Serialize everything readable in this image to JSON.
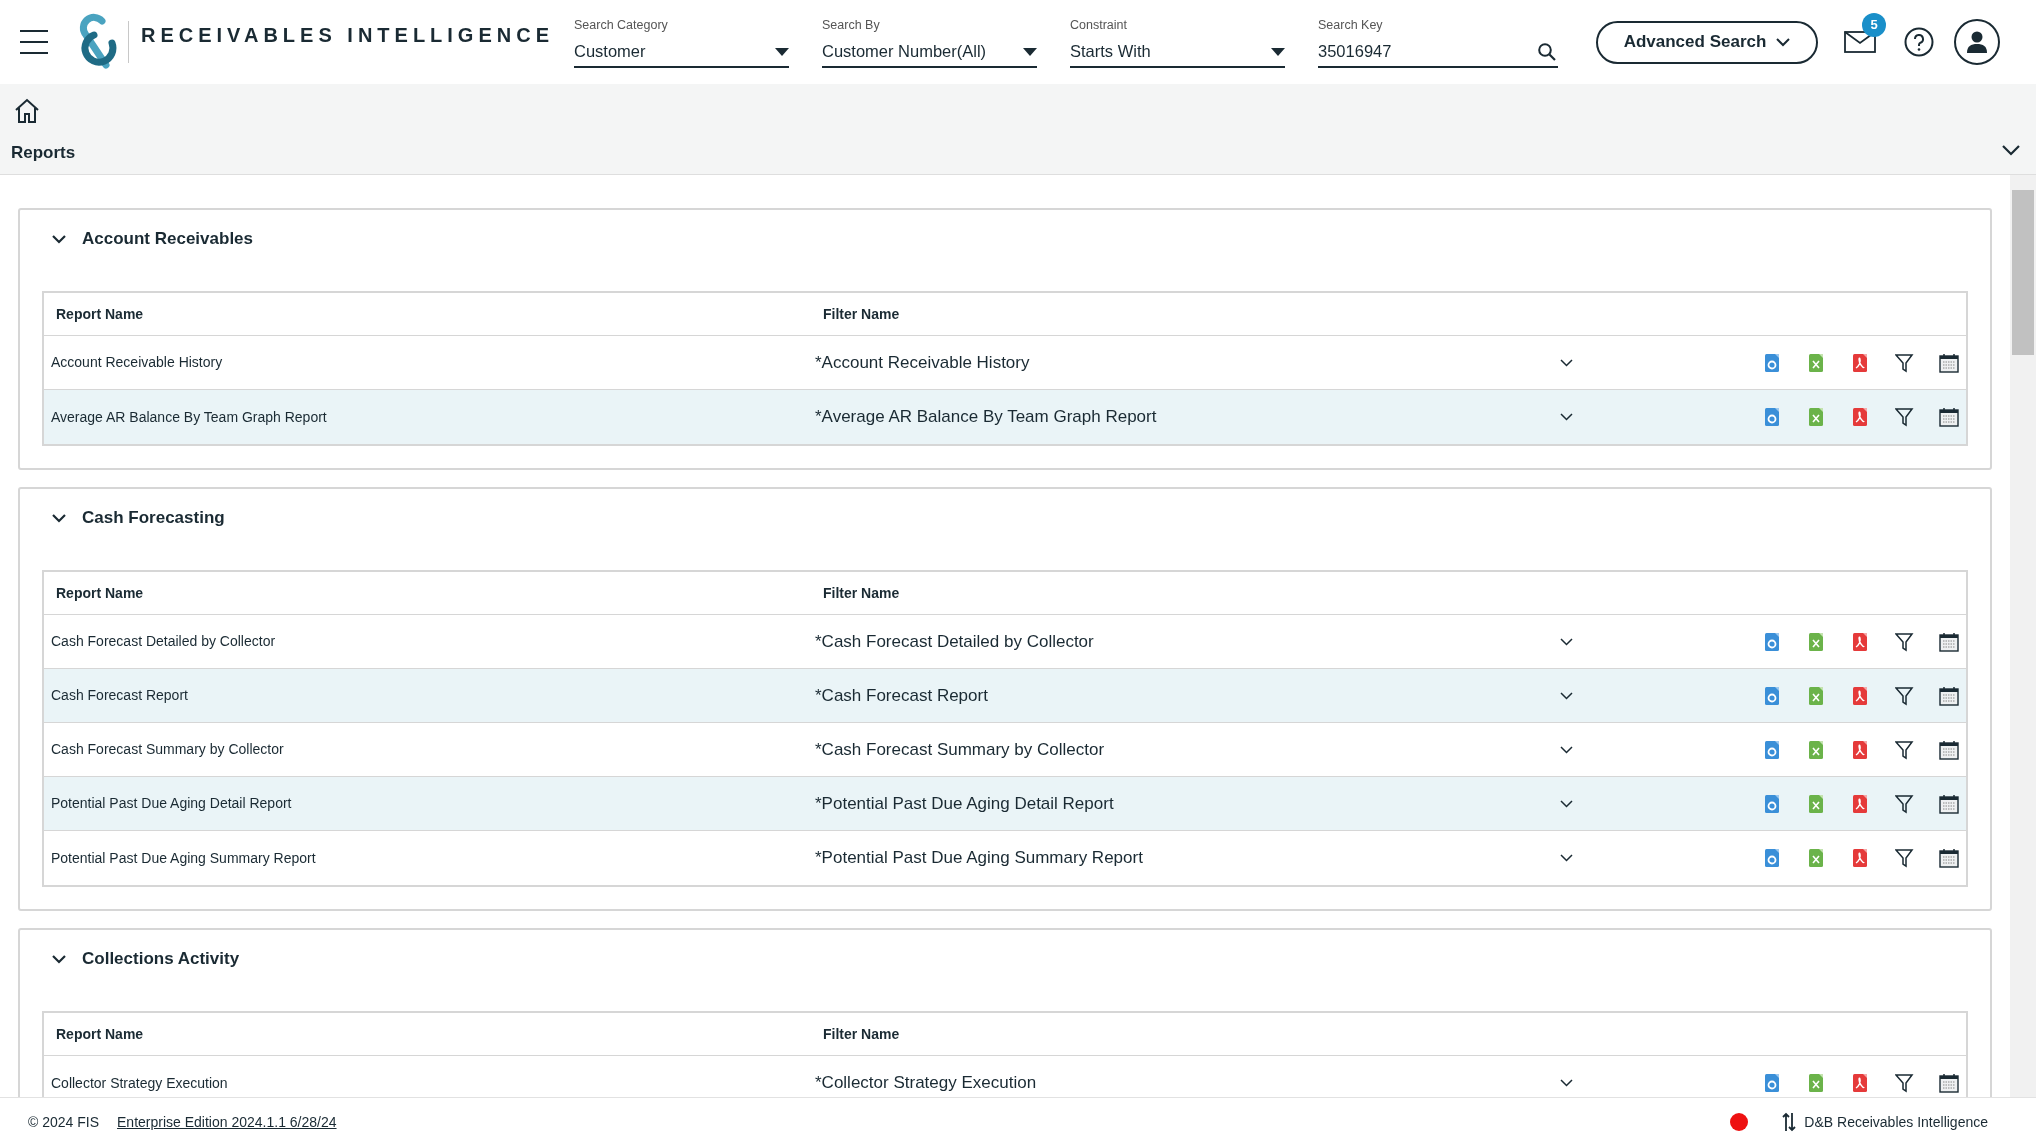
{
  "header": {
    "app_title": "RECEIVABLES INTELLIGENCE",
    "search_fields": [
      {
        "kind": "select",
        "label": "Search Category",
        "value": "Customer"
      },
      {
        "kind": "select",
        "label": "Search By",
        "value": "Customer Number(All)"
      },
      {
        "kind": "select",
        "label": "Constraint",
        "value": "Starts With"
      },
      {
        "kind": "text",
        "label": "Search Key",
        "value": "35016947"
      }
    ],
    "advanced_search": "Advanced Search",
    "notification_count": "5"
  },
  "page_title": "Reports",
  "sections": [
    {
      "title": "Account Receivables",
      "expanded": true,
      "columns": [
        "Report Name",
        "Filter Name"
      ],
      "rows": [
        {
          "report": "Account Receivable History",
          "filter": "*Account Receivable History"
        },
        {
          "report": "Average AR Balance By Team Graph Report",
          "filter": "*Average AR Balance By Team Graph Report"
        }
      ]
    },
    {
      "title": "Cash Forecasting",
      "expanded": true,
      "columns": [
        "Report Name",
        "Filter Name"
      ],
      "rows": [
        {
          "report": "Cash Forecast Detailed by Collector",
          "filter": "*Cash Forecast Detailed by Collector"
        },
        {
          "report": "Cash Forecast Report",
          "filter": "*Cash Forecast Report"
        },
        {
          "report": "Cash Forecast Summary by Collector",
          "filter": "*Cash Forecast Summary by Collector"
        },
        {
          "report": "Potential Past Due Aging Detail Report",
          "filter": "*Potential Past Due Aging Detail Report"
        },
        {
          "report": "Potential Past Due Aging Summary Report",
          "filter": "*Potential Past Due Aging Summary Report"
        }
      ]
    },
    {
      "title": "Collections Activity",
      "expanded": true,
      "columns": [
        "Report Name",
        "Filter Name"
      ],
      "rows": [
        {
          "report": "Collector Strategy Execution",
          "filter": "*Collector Strategy Execution"
        }
      ]
    }
  ],
  "footer": {
    "copyright": "© 2024 FIS",
    "edition": "Enterprise Edition 2024.1.1 6/28/24",
    "product": "D&B Receivables Intelligence"
  }
}
